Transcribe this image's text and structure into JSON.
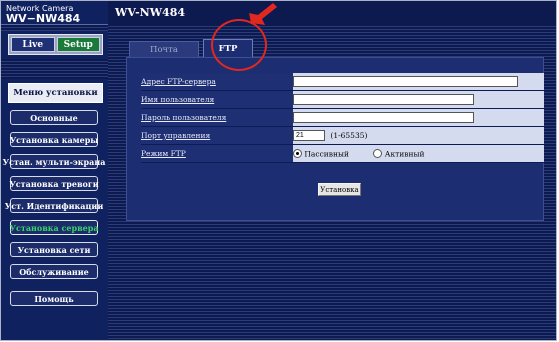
{
  "brand": {
    "line1": "Network Camera",
    "line2": "WV−NW484"
  },
  "header": {
    "model": "WV-NW484"
  },
  "top_buttons": {
    "live": "Live",
    "setup": "Setup"
  },
  "menu": {
    "title": "Меню установки",
    "items": [
      {
        "label": "Основные"
      },
      {
        "label": "Установка камеры"
      },
      {
        "label": "Устан. мульти-экрана"
      },
      {
        "label": "Установка тревоги"
      },
      {
        "label": "Уст. Идентификации"
      },
      {
        "label": "Установка сервера",
        "active": true
      },
      {
        "label": "Установка сети"
      },
      {
        "label": "Обслуживание"
      }
    ],
    "help": "Помощь"
  },
  "tabs": [
    {
      "label": "Почта"
    },
    {
      "label": "FTP",
      "selected": true
    }
  ],
  "ftp_form": {
    "server_label": "Адрес FTP-сервера",
    "server_value": "",
    "user_label": "Имя пользователя",
    "user_value": "",
    "password_label": "Пароль пользователя",
    "password_value": "",
    "port_label": "Порт управления",
    "port_value": "21",
    "port_range": "(1-65535)",
    "mode_label": "Режим FTP",
    "mode_passive": "Пассивный",
    "mode_active": "Активный",
    "mode_selected": "Пассивный"
  },
  "set_button": "Установка",
  "colors": {
    "annotation": "#e0281f",
    "active_menu": "#39d46a"
  }
}
